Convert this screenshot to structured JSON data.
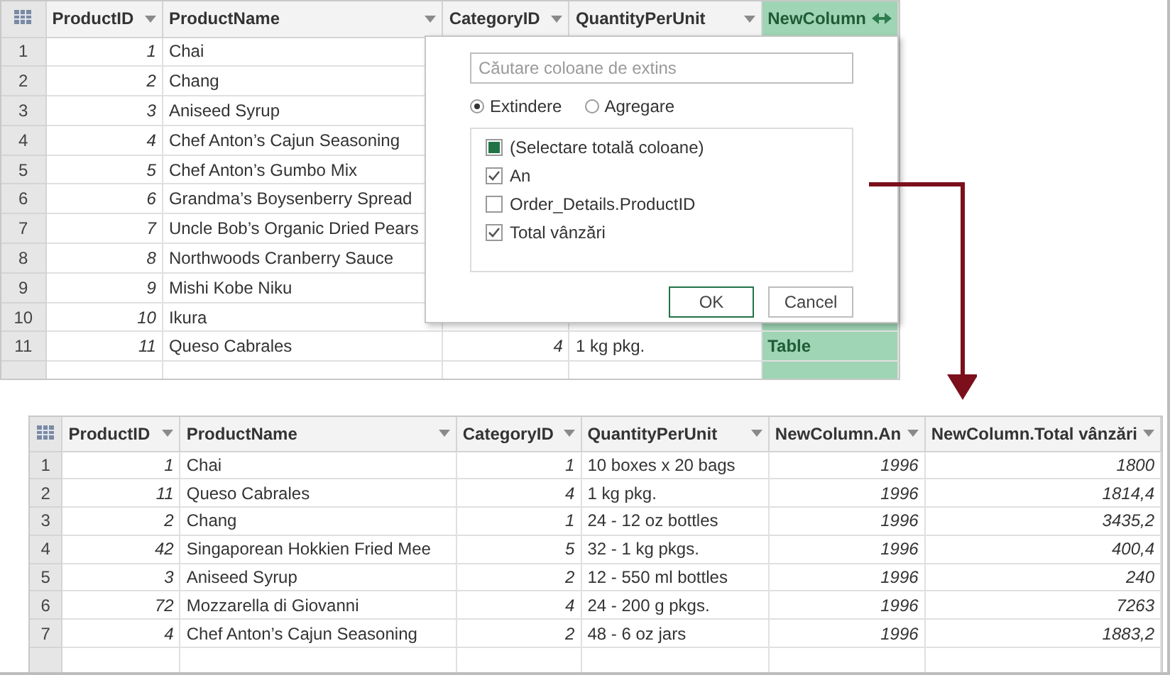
{
  "before_table": {
    "columns": [
      {
        "label": "ProductID",
        "kind": "number"
      },
      {
        "label": "ProductName",
        "kind": "text"
      },
      {
        "label": "CategoryID",
        "kind": "number"
      },
      {
        "label": "QuantityPerUnit",
        "kind": "text"
      },
      {
        "label": "NewColumn",
        "kind": "table"
      }
    ],
    "rows": [
      {
        "number": "1",
        "cells": [
          "1",
          "Chai"
        ]
      },
      {
        "number": "2",
        "cells": [
          "2",
          "Chang"
        ]
      },
      {
        "number": "3",
        "cells": [
          "3",
          "Aniseed Syrup"
        ]
      },
      {
        "number": "4",
        "cells": [
          "4",
          "Chef Anton’s Cajun Seasoning"
        ]
      },
      {
        "number": "5",
        "cells": [
          "5",
          "Chef Anton’s Gumbo Mix"
        ]
      },
      {
        "number": "6",
        "cells": [
          "6",
          "Grandma’s Boysenberry Spread"
        ]
      },
      {
        "number": "7",
        "cells": [
          "7",
          "Uncle Bob’s Organic Dried Pears"
        ]
      },
      {
        "number": "8",
        "cells": [
          "8",
          "Northwoods Cranberry Sauce"
        ]
      },
      {
        "number": "9",
        "cells": [
          "9",
          "Mishi Kobe Niku"
        ]
      },
      {
        "number": "10",
        "cells": [
          "10",
          "Ikura"
        ]
      },
      {
        "number": "11",
        "cells": [
          "11",
          "Queso Cabrales",
          "4",
          "1 kg pkg.",
          "Table"
        ]
      }
    ]
  },
  "expand_dialog": {
    "search": {
      "placeholder": "Căutare coloane de extins"
    },
    "modes": [
      {
        "label": "Extindere",
        "selected": true
      },
      {
        "label": "Agregare",
        "selected": false
      }
    ],
    "columns": [
      {
        "label": "(Selectare totală coloane)",
        "kind": "select-all",
        "checked": true
      },
      {
        "label": "An",
        "kind": "column",
        "checked": true
      },
      {
        "label": "Order_Details.ProductID",
        "kind": "column",
        "checked": false
      },
      {
        "label": "Total vânzări",
        "kind": "column",
        "checked": true
      }
    ],
    "buttons": [
      {
        "label": "OK",
        "kind": "primary"
      },
      {
        "label": "Cancel",
        "kind": "secondary"
      }
    ]
  },
  "after_table": {
    "columns": [
      {
        "label": "ProductID",
        "kind": "number"
      },
      {
        "label": "ProductName",
        "kind": "text"
      },
      {
        "label": "CategoryID",
        "kind": "number"
      },
      {
        "label": "QuantityPerUnit",
        "kind": "text"
      },
      {
        "label": "NewColumn.An",
        "kind": "number"
      },
      {
        "label": "NewColumn.Total vânzări",
        "kind": "number"
      }
    ],
    "rows": [
      {
        "number": "1",
        "cells": [
          "1",
          "Chai",
          "1",
          "10 boxes x 20 bags",
          "1996",
          "1800"
        ]
      },
      {
        "number": "2",
        "cells": [
          "11",
          "Queso Cabrales",
          "4",
          "1 kg pkg.",
          "1996",
          "1814,4"
        ]
      },
      {
        "number": "3",
        "cells": [
          "2",
          "Chang",
          "1",
          "24 - 12 oz bottles",
          "1996",
          "3435,2"
        ]
      },
      {
        "number": "4",
        "cells": [
          "42",
          "Singaporean Hokkien Fried Mee",
          "5",
          "32 - 1 kg pkgs.",
          "1996",
          "400,4"
        ]
      },
      {
        "number": "5",
        "cells": [
          "3",
          "Aniseed Syrup",
          "2",
          "12 - 550 ml bottles",
          "1996",
          "240"
        ]
      },
      {
        "number": "6",
        "cells": [
          "72",
          "Mozzarella di Giovanni",
          "4",
          "24 - 200 g pkgs.",
          "1996",
          "7263"
        ]
      },
      {
        "number": "7",
        "cells": [
          "4",
          "Chef Anton’s Cajun Seasoning",
          "2",
          "48 - 6 oz jars",
          "1996",
          "1883,2"
        ]
      }
    ]
  }
}
